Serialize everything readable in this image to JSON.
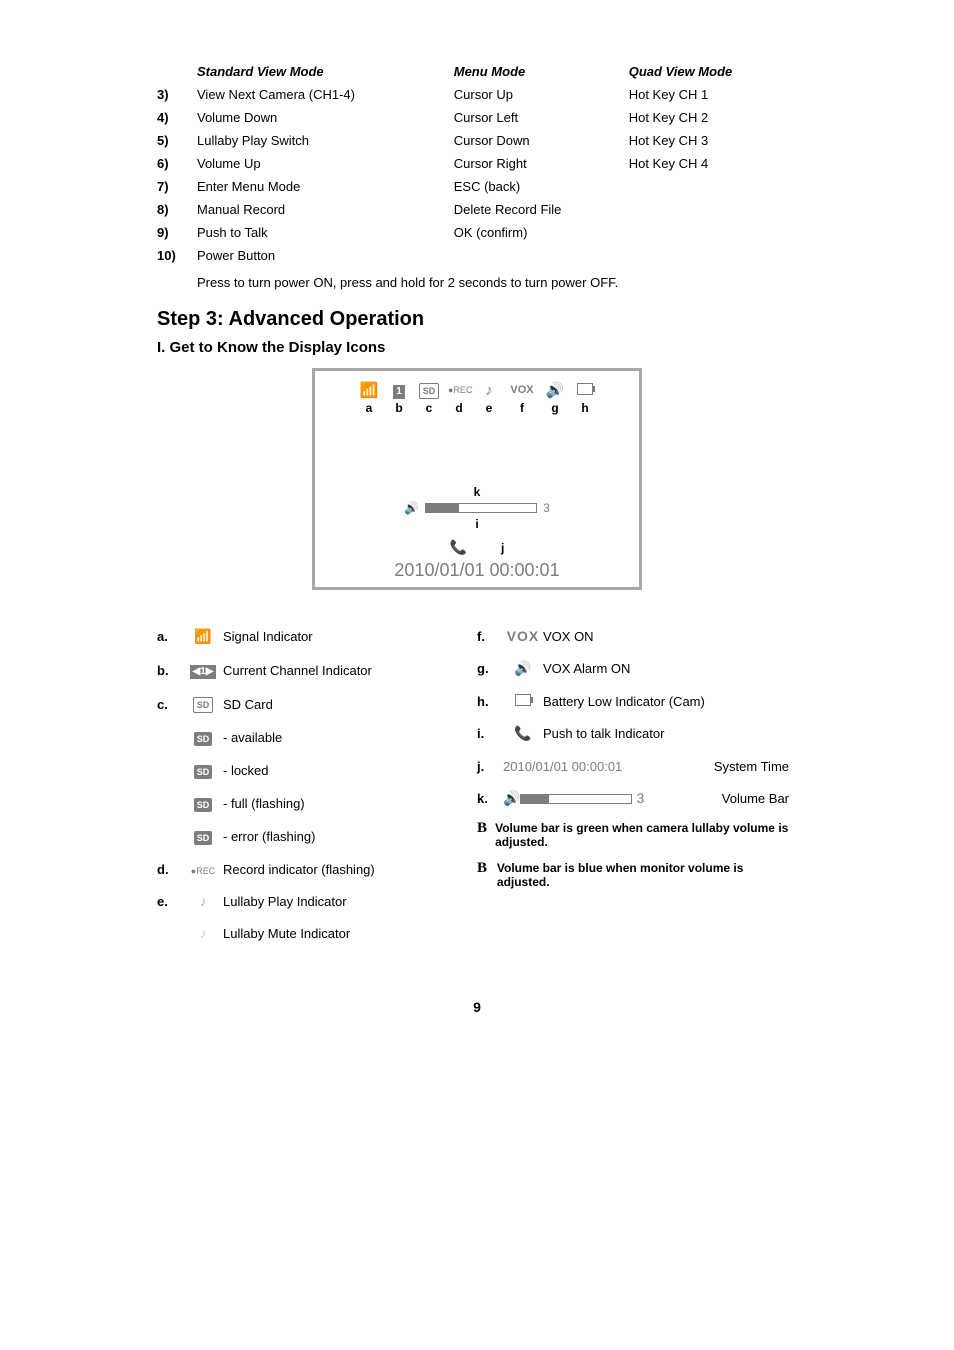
{
  "modes_table": {
    "headers": {
      "std": "Standard View Mode",
      "menu": "Menu Mode",
      "quad": "Quad View Mode"
    },
    "rows": [
      {
        "n": "3)",
        "std": "View Next Camera (CH1-4)",
        "menu": "Cursor Up",
        "quad": "Hot Key CH 1"
      },
      {
        "n": "4)",
        "std": "Volume Down",
        "menu": "Cursor Left",
        "quad": "Hot Key CH 2"
      },
      {
        "n": "5)",
        "std": "Lullaby Play Switch",
        "menu": "Cursor Down",
        "quad": "Hot Key CH 3"
      },
      {
        "n": "6)",
        "std": "Volume Up",
        "menu": "Cursor Right",
        "quad": "Hot Key CH 4"
      },
      {
        "n": "7)",
        "std": "Enter Menu Mode",
        "menu": "ESC (back)",
        "quad": ""
      },
      {
        "n": "8)",
        "std": "Manual Record",
        "menu": "Delete Record File",
        "quad": ""
      },
      {
        "n": "9)",
        "std": "Push to Talk",
        "menu": "OK (confirm)",
        "quad": ""
      },
      {
        "n": "10)",
        "std": "Power Button",
        "menu": "",
        "quad": ""
      }
    ],
    "footnote": "Press to turn power ON, press and hold for 2 seconds to turn power OFF."
  },
  "step_heading": "Step 3: Advanced Operation",
  "sub_heading": "I. Get to Know the Display Icons",
  "figure": {
    "labels": {
      "a": "a",
      "b": "b",
      "c": "c",
      "d": "d",
      "e": "e",
      "f": "f",
      "g": "g",
      "h": "h",
      "i": "i",
      "j": "j",
      "k": "k"
    },
    "vox_text": "VOX",
    "ch_text": "1",
    "sd_text": "SD",
    "rec_text": "REC",
    "vol_level": "3",
    "systime": "2010/01/01 00:00:01"
  },
  "legend_left": [
    {
      "k": "a.",
      "icon": "signal-icon",
      "glyph": "((📶))",
      "text": "Signal Indicator"
    },
    {
      "k": "b.",
      "icon": "channel-icon",
      "glyph": "CH1",
      "text": "Current Channel Indicator"
    },
    {
      "k": "c.",
      "icon": "sd-card-icon",
      "glyph": "SD",
      "text": "SD Card"
    },
    {
      "k": "",
      "icon": "sd-available-icon",
      "glyph": "SD",
      "text": "- available"
    },
    {
      "k": "",
      "icon": "sd-locked-icon",
      "glyph": "SD🔒",
      "text": "- locked"
    },
    {
      "k": "",
      "icon": "sd-full-icon",
      "glyph": "SD⧗",
      "text": "- full (flashing)"
    },
    {
      "k": "",
      "icon": "sd-error-icon",
      "glyph": "SD✕",
      "text": "- error (flashing)"
    },
    {
      "k": "d.",
      "icon": "record-icon",
      "glyph": "REC",
      "text": "Record indicator (flashing)"
    },
    {
      "k": "e.",
      "icon": "lullaby-play-icon",
      "glyph": "♪",
      "text": "Lullaby Play Indicator"
    },
    {
      "k": "",
      "icon": "lullaby-mute-icon",
      "glyph": "♪",
      "text": "Lullaby Mute Indicator"
    }
  ],
  "legend_right": [
    {
      "k": "f.",
      "icon": "vox-on-icon",
      "glyph": "VOX",
      "text": "VOX ON"
    },
    {
      "k": "g.",
      "icon": "vox-alarm-icon",
      "glyph": "🔊",
      "text": "VOX Alarm ON"
    },
    {
      "k": "h.",
      "icon": "battery-low-icon",
      "glyph": "batt",
      "text": "Battery Low Indicator (Cam)"
    },
    {
      "k": "i.",
      "icon": "push-to-talk-icon",
      "glyph": "📞",
      "text": "Push to talk Indicator"
    },
    {
      "k": "j.",
      "icon": "system-time-icon",
      "glyph": "2010/01/01 00:00:01",
      "text": "System Time"
    },
    {
      "k": "k.",
      "icon": "volume-bar-icon",
      "glyph": "volbar",
      "vol_num": "3",
      "text": "Volume Bar"
    }
  ],
  "notes": [
    "Volume bar is green when camera lullaby volume is adjusted.",
    "Volume bar is blue when monitor volume is adjusted."
  ],
  "note_marker": "B",
  "page_number": "9"
}
